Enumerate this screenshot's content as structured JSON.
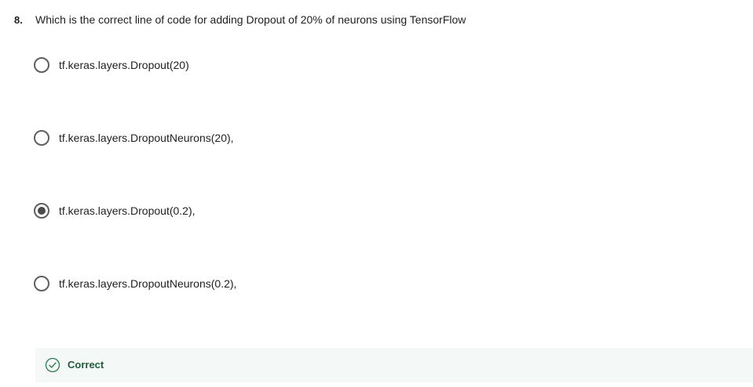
{
  "question": {
    "number": "8.",
    "text": "Which is the correct line of code for adding Dropout of 20% of neurons using TensorFlow"
  },
  "options": [
    {
      "label": "tf.keras.layers.Dropout(20)",
      "selected": false
    },
    {
      "label": "tf.keras.layers.DropoutNeurons(20),",
      "selected": false
    },
    {
      "label": "tf.keras.layers.Dropout(0.2),",
      "selected": true
    },
    {
      "label": "tf.keras.layers.DropoutNeurons(0.2),",
      "selected": false
    }
  ],
  "feedback": {
    "status": "Correct",
    "icon": "check-circle-icon",
    "color": "#1e5c3a",
    "background": "#f4f8f6"
  }
}
